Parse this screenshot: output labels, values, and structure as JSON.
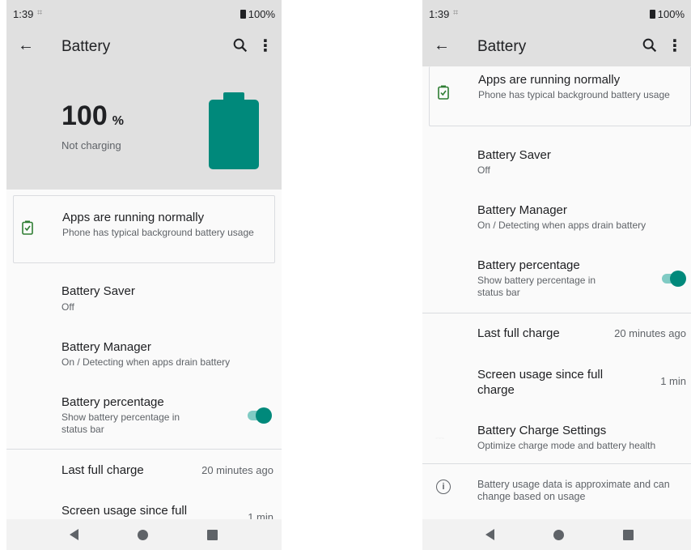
{
  "status": {
    "time": "1:39",
    "battery": "100%"
  },
  "appbar": {
    "title": "Battery",
    "back_icon": "arrow-back-icon",
    "search_icon": "search-icon",
    "more_icon": "more-vert-icon"
  },
  "hero": {
    "percent": "100",
    "percent_sign": "%",
    "charging": "Not charging",
    "battery_color": "#00897b"
  },
  "card": {
    "title": "Apps are running normally",
    "subtitle": "Phone has typical background battery usage"
  },
  "battery_saver": {
    "title": "Battery Saver",
    "subtitle": "Off"
  },
  "battery_manager": {
    "title": "Battery Manager",
    "subtitle": "On / Detecting when apps drain battery"
  },
  "battery_percentage": {
    "title": "Battery percentage",
    "subtitle": "Show battery percentage in status bar",
    "enabled": true
  },
  "last_full_charge": {
    "title": "Last full charge",
    "value": "20 minutes ago"
  },
  "screen_usage": {
    "title": "Screen usage since full charge",
    "value": "1 min"
  },
  "charge_settings": {
    "title": "Battery Charge Settings",
    "subtitle": "Optimize charge mode and battery health"
  },
  "footer": {
    "info": "Battery usage data is approximate and can change based on usage"
  },
  "colors": {
    "accent": "#00897b",
    "accent_light": "#80cbc4",
    "header_bg": "#e0e0e0"
  }
}
